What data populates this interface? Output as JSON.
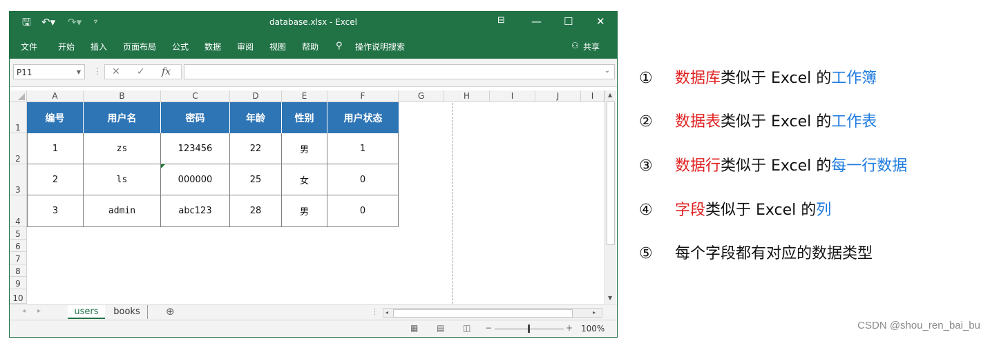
{
  "window": {
    "title": "database.xlsx  -  Excel",
    "qat": {
      "save_icon": "save-icon",
      "undo_icon": "undo-icon",
      "redo_icon": "redo-icon",
      "customize_icon": "customize-icon"
    },
    "controls": {
      "ribbon_display": "ribbon-display-icon",
      "minimize": "—",
      "maximize": "☐",
      "close": "✕"
    }
  },
  "ribbon": {
    "tabs": [
      "文件",
      "开始",
      "插入",
      "页面布局",
      "公式",
      "数据",
      "审阅",
      "视图",
      "帮助"
    ],
    "tell_me": "操作说明搜索",
    "share": "共享"
  },
  "formula_bar": {
    "name_box": "P11",
    "cancel": "✕",
    "enter": "✓",
    "fx": "fx",
    "value": ""
  },
  "sheet": {
    "columns": [
      "A",
      "B",
      "C",
      "D",
      "E",
      "F",
      "G",
      "H",
      "I",
      "J",
      "I"
    ],
    "rows": [
      "1",
      "2",
      "3",
      "4",
      "5",
      "6",
      "7",
      "8",
      "9",
      "10"
    ],
    "header": [
      "编号",
      "用户名",
      "密码",
      "年龄",
      "性别",
      "用户状态"
    ],
    "data": [
      [
        "1",
        "zs",
        "123456",
        "22",
        "男",
        "1"
      ],
      [
        "2",
        "ls",
        "000000",
        "25",
        "女",
        "0"
      ],
      [
        "3",
        "admin",
        "abc123",
        "28",
        "男",
        "0"
      ]
    ],
    "header_color": "#2e75b6"
  },
  "sheet_tabs": {
    "tabs": [
      "users",
      "books"
    ],
    "active": "users",
    "add": "⊕"
  },
  "status": {
    "zoom": "100%",
    "zoom_minus": "−",
    "zoom_plus": "+"
  },
  "notes": [
    {
      "num": "①",
      "a": "数据库",
      "b": "类似于 Excel 的",
      "c": "工作簿"
    },
    {
      "num": "②",
      "a": "数据表",
      "b": "类似于 Excel 的",
      "c": "工作表"
    },
    {
      "num": "③",
      "a": "数据行",
      "b": "类似于 Excel 的",
      "c": "每一行数据"
    },
    {
      "num": "④",
      "a": "字段",
      "b": "类似于 Excel 的",
      "c": "列"
    },
    {
      "num": "⑤",
      "a": "",
      "b": "每个字段都有对应的数据类型",
      "c": ""
    }
  ],
  "watermark": "CSDN @shou_ren_bai_bu",
  "colors": {
    "excel_green": "#217346",
    "red": "#e02020",
    "blue": "#1e7be0"
  }
}
